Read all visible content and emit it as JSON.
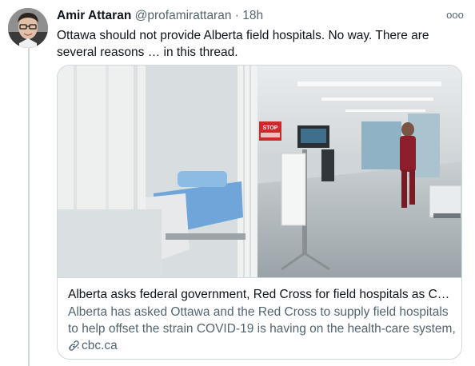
{
  "tweet": {
    "author_name": "Amir Attaran",
    "author_handle": "@profamirattaran",
    "separator": "·",
    "time": "18h",
    "more_label": "ooo",
    "text": "Ottawa should not provide Alberta field hospitals.  No way.  There are several reasons … in this thread."
  },
  "card": {
    "title": "Alberta asks federal government, Red Cross for field hospitals as COVID…",
    "description": "Alberta has asked Ottawa and the Red Cross to supply field hospitals to help offset the strain COVID-19 is having on the health-care system, …",
    "domain": "cbc.ca",
    "sign_text": "STOP"
  },
  "icons": {
    "more": "more-options-icon",
    "link": "link-icon"
  },
  "colors": {
    "primary_text": "#0f1419",
    "secondary_text": "#536471",
    "border": "#cfd9de"
  }
}
